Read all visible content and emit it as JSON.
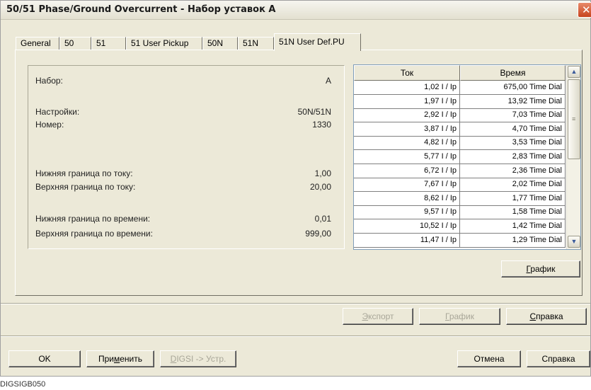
{
  "window": {
    "title": "50/51 Phase/Ground Overcurrent - Набор уставок A",
    "close_glyph": "✕"
  },
  "tabs": [
    {
      "label": "General"
    },
    {
      "label": "50"
    },
    {
      "label": "51"
    },
    {
      "label": "51 User Pickup"
    },
    {
      "label": "50N"
    },
    {
      "label": "51N"
    },
    {
      "label": "51N User Def.PU"
    }
  ],
  "params": [
    {
      "label": "Набор:",
      "value": "A"
    },
    {
      "label": "Настройки:",
      "value": "50N/51N"
    },
    {
      "label": "Номер:",
      "value": "1330"
    },
    {
      "label": "Нижняя граница по току:",
      "value": "1,00"
    },
    {
      "label": "Верхняя граница по току:",
      "value": "20,00"
    },
    {
      "label": "Нижняя граница по времени:",
      "value": "0,01"
    },
    {
      "label": "Верхняя граница по времени:",
      "value": "999,00"
    }
  ],
  "table": {
    "columns": [
      "Ток",
      "Время"
    ],
    "rows": [
      [
        "1,02 I / Ip",
        "675,00 Time Dial"
      ],
      [
        "1,97 I / Ip",
        "13,92 Time Dial"
      ],
      [
        "2,92 I / Ip",
        "7,03 Time Dial"
      ],
      [
        "3,87 I / Ip",
        "4,70 Time Dial"
      ],
      [
        "4,82 I / Ip",
        "3,53 Time Dial"
      ],
      [
        "5,77 I / Ip",
        "2,83 Time Dial"
      ],
      [
        "6,72 I / Ip",
        "2,36 Time Dial"
      ],
      [
        "7,67 I / Ip",
        "2,02 Time Dial"
      ],
      [
        "8,62 I / Ip",
        "1,77 Time Dial"
      ],
      [
        "9,57 I / Ip",
        "1,58 Time Dial"
      ],
      [
        "10,52 I / Ip",
        "1,42 Time Dial"
      ],
      [
        "11,47 I / Ip",
        "1,29 Time Dial"
      ]
    ]
  },
  "buttons": {
    "graph_inner": {
      "pre": "",
      "u": "Г",
      "post": "рафик"
    },
    "export": {
      "pre": "",
      "u": "Э",
      "post": "кспорт"
    },
    "graph_lower": {
      "pre": "",
      "u": "Г",
      "post": "рафик"
    },
    "help_lower": {
      "pre": "",
      "u": "С",
      "post": "правка"
    },
    "ok": "OK",
    "apply": {
      "pre": "При",
      "u": "м",
      "post": "енить"
    },
    "digsi": {
      "pre": "",
      "u": "D",
      "post": "IGSI -> Устр."
    },
    "cancel": "Отмена",
    "help": "Справка"
  },
  "caption": "DIGSIGB050"
}
